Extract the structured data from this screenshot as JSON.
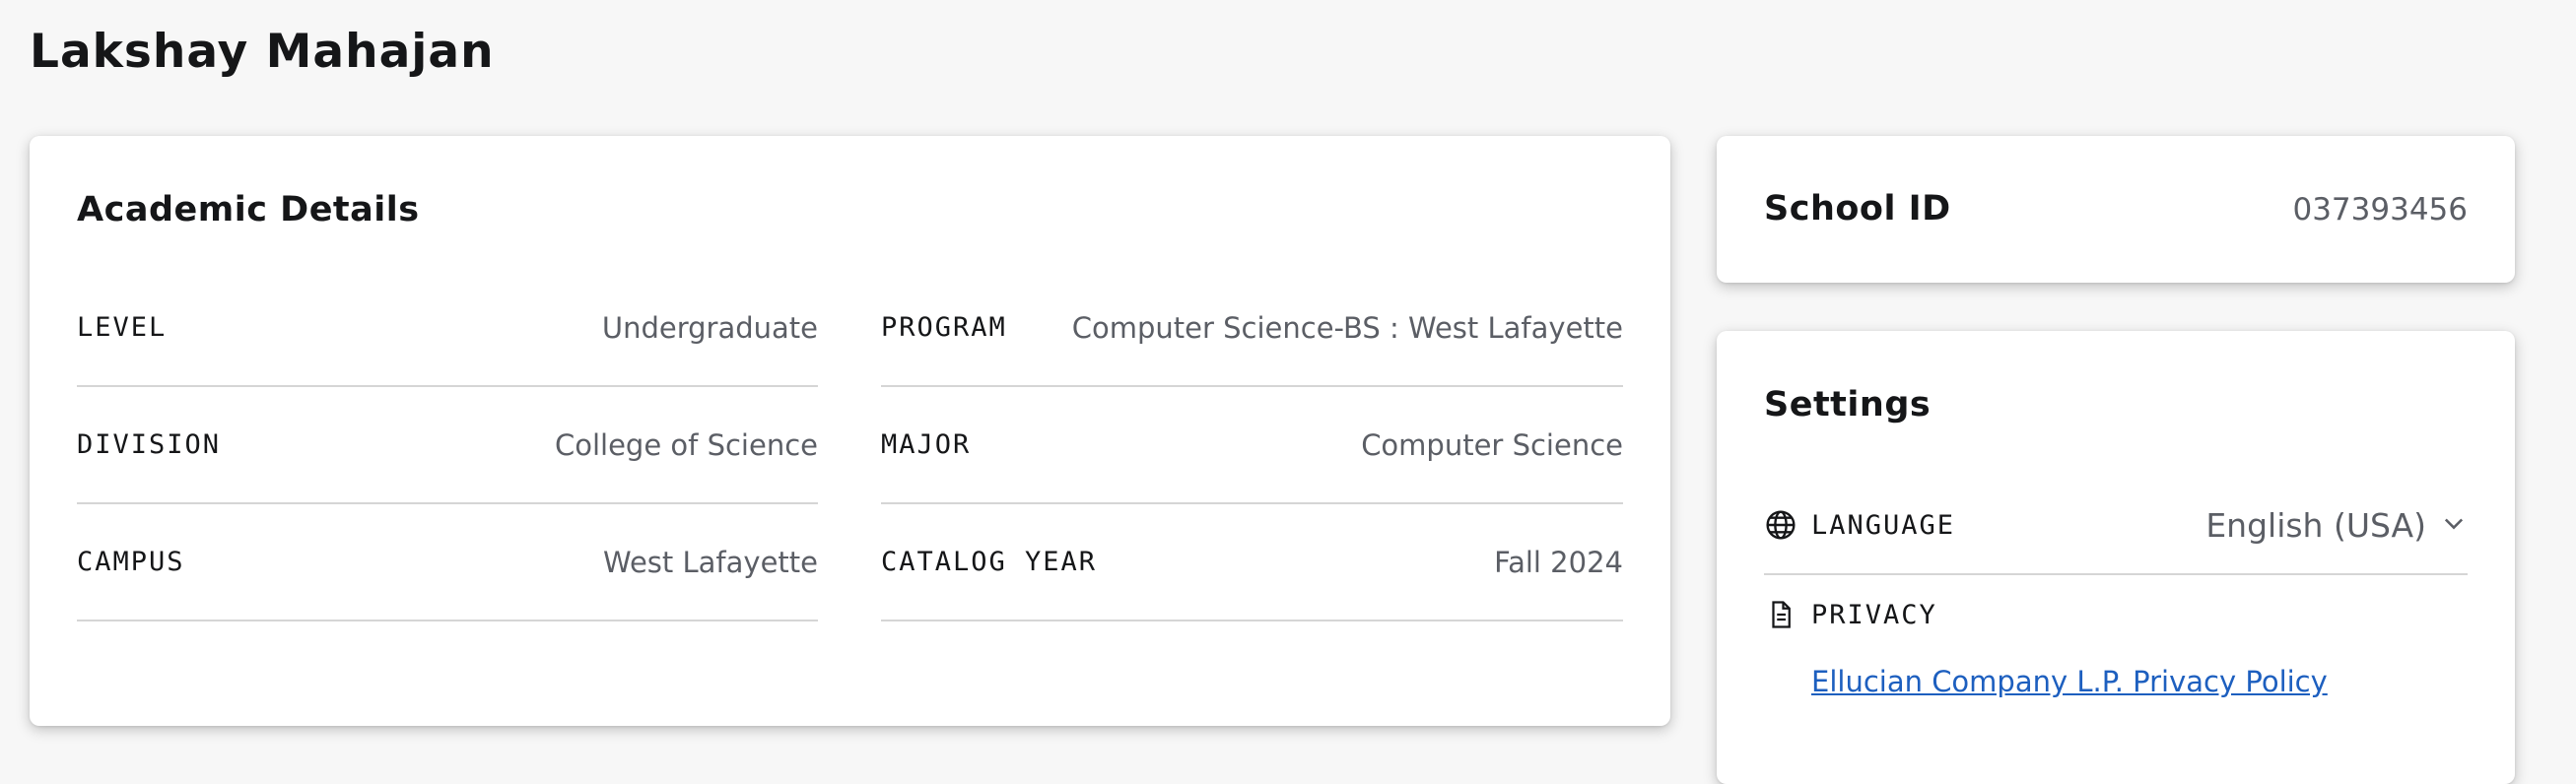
{
  "page": {
    "title": "Lakshay Mahajan"
  },
  "academic": {
    "title": "Academic Details",
    "left": [
      {
        "label": "LEVEL",
        "value": "Undergraduate"
      },
      {
        "label": "DIVISION",
        "value": "College of Science"
      },
      {
        "label": "CAMPUS",
        "value": "West Lafayette"
      }
    ],
    "right": [
      {
        "label": "PROGRAM",
        "value": "Computer Science-BS : West Lafayette"
      },
      {
        "label": "MAJOR",
        "value": "Computer Science"
      },
      {
        "label": "CATALOG YEAR",
        "value": "Fall 2024"
      }
    ]
  },
  "school_id": {
    "label": "School ID",
    "value": "037393456"
  },
  "settings": {
    "title": "Settings",
    "language": {
      "icon": "globe-icon",
      "label": "LANGUAGE",
      "selected": "English (USA)"
    },
    "privacy": {
      "icon": "document-icon",
      "label": "PRIVACY",
      "link_text": "Ellucian Company L.P. Privacy Policy"
    }
  },
  "colors": {
    "link": "#1d5fbf",
    "value_text": "#5b5e65",
    "divider": "#d5d5d5"
  }
}
